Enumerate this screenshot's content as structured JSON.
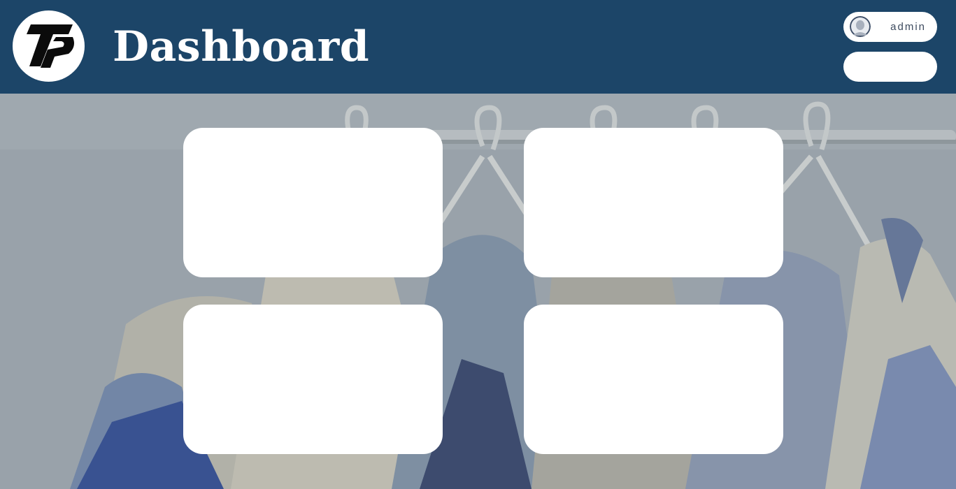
{
  "header": {
    "title": "Dashboard",
    "logo_icon": "brand-logo-icon",
    "background_color": "#1c4568"
  },
  "user": {
    "name": "admin",
    "avatar_icon": "user-avatar-icon"
  },
  "secondary_button": {
    "label": ""
  },
  "cards": [
    {
      "id": "card-1",
      "label": ""
    },
    {
      "id": "card-2",
      "label": ""
    },
    {
      "id": "card-3",
      "label": ""
    },
    {
      "id": "card-4",
      "label": ""
    }
  ],
  "background": {
    "subject": "clothes-rack-illustration",
    "tint": "#9aa3ad"
  }
}
